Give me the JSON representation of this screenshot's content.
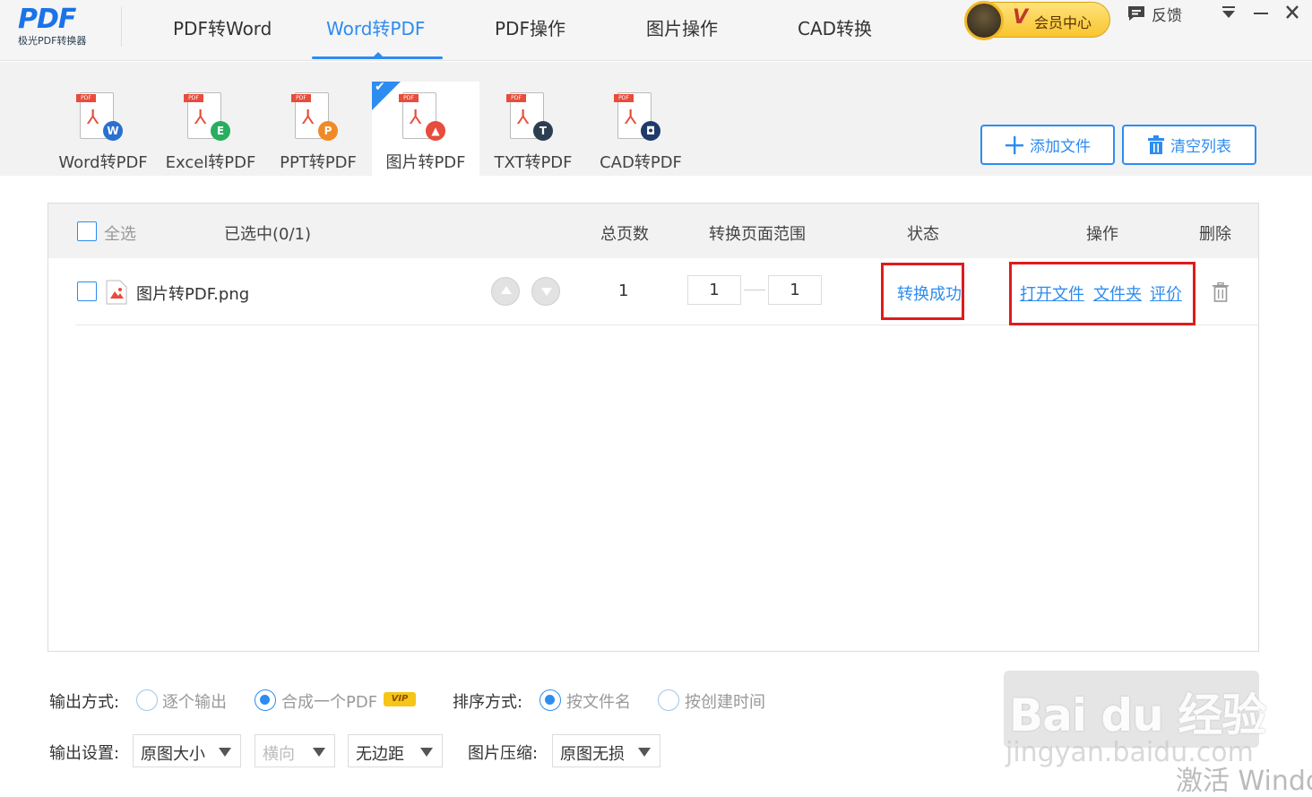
{
  "app": {
    "logo_mark": "PDF",
    "logo_sub": "极光PDF转换器",
    "vip_label": "会员中心",
    "vip_v": "V",
    "feedback_label": "反馈"
  },
  "nav": {
    "tabs": [
      {
        "label": "PDF转Word",
        "active": false
      },
      {
        "label": "Word转PDF",
        "active": true
      },
      {
        "label": "PDF操作",
        "active": false
      },
      {
        "label": "图片操作",
        "active": false
      },
      {
        "label": "CAD转换",
        "active": false
      }
    ]
  },
  "formats": {
    "items": [
      {
        "label": "Word转PDF",
        "badge": "W",
        "badge_color": "#2b6fd1"
      },
      {
        "label": "Excel转PDF",
        "badge": "E",
        "badge_color": "#27ae60"
      },
      {
        "label": "PPT转PDF",
        "badge": "P",
        "badge_color": "#f08a24"
      },
      {
        "label": "图片转PDF",
        "badge": "▲",
        "badge_color": "#e74c3c"
      },
      {
        "label": "TXT转PDF",
        "badge": "T",
        "badge_color": "#2c3e50"
      },
      {
        "label": "CAD转PDF",
        "badge": "◘",
        "badge_color": "#1f3a6b"
      }
    ],
    "selected": "图片转PDF"
  },
  "toolbar": {
    "add_label": "添加文件",
    "clear_label": "清空列表"
  },
  "table": {
    "select_all": "全选",
    "selected_count": "已选中(0/1)",
    "col_pages": "总页数",
    "col_range": "转换页面范围",
    "col_status": "状态",
    "col_actions": "操作",
    "col_delete": "删除",
    "rows": [
      {
        "filename": "图片转PDF.png",
        "pages": "1",
        "range_from": "1",
        "range_to": "1",
        "status": "转换成功",
        "open_file": "打开文件",
        "folder": "文件夹",
        "rate": "评价"
      }
    ]
  },
  "options": {
    "output_mode_label": "输出方式:",
    "output_each": "逐个输出",
    "output_merge": "合成一个PDF",
    "vip_badge": "VIP",
    "sort_label": "排序方式:",
    "sort_by_name": "按文件名",
    "sort_by_time": "按创建时间",
    "output_settings_label": "输出设置:",
    "size_value": "原图大小",
    "orientation_value": "横向",
    "margin_value": "无边距",
    "compress_label": "图片压缩:",
    "compress_value": "原图无损"
  },
  "overlay": {
    "watermark_text": "Bai du 经验",
    "watermark_url": "jingyan.baidu.com",
    "activate_text": "激活 Windo"
  },
  "colors": {
    "accent": "#2d8cf0",
    "highlight_box": "#e01b1b"
  }
}
